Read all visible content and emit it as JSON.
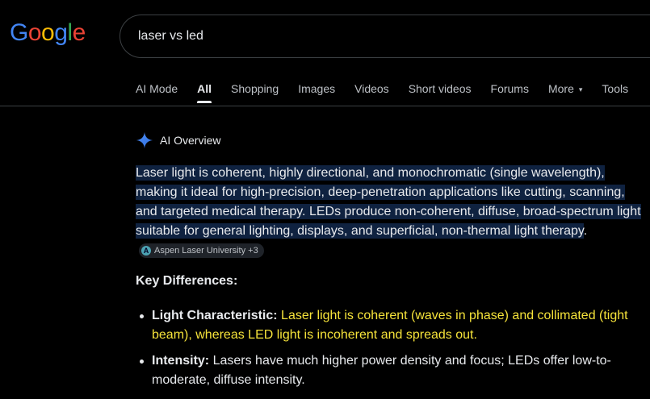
{
  "logo": {
    "letters": [
      {
        "ch": "G",
        "color": "#4285f4"
      },
      {
        "ch": "o",
        "color": "#ea4335"
      },
      {
        "ch": "o",
        "color": "#fbbc05"
      },
      {
        "ch": "g",
        "color": "#4285f4"
      },
      {
        "ch": "l",
        "color": "#34a853"
      },
      {
        "ch": "e",
        "color": "#ea4335"
      }
    ]
  },
  "search": {
    "query": "laser vs led"
  },
  "tabs": [
    {
      "label": "AI Mode",
      "active": false
    },
    {
      "label": "All",
      "active": true
    },
    {
      "label": "Shopping",
      "active": false
    },
    {
      "label": "Images",
      "active": false
    },
    {
      "label": "Videos",
      "active": false
    },
    {
      "label": "Short videos",
      "active": false
    },
    {
      "label": "Forums",
      "active": false
    },
    {
      "label": "More",
      "active": false,
      "dropdown": true
    },
    {
      "label": "Tools",
      "active": false
    }
  ],
  "ai_overview": {
    "label": "AI Overview",
    "icon": "sparkle-icon",
    "summary": "Laser light is coherent, highly directional, and monochromatic (single wavelength), making it ideal for high-precision, deep-penetration applications like cutting, scanning, and targeted medical therapy. LEDs produce non-coherent, diffuse, broad-spectrum light suitable for general lighting, displays, and superficial, non-thermal light therapy",
    "summary_end": ".",
    "citation": "Aspen Laser University +3",
    "key_heading": "Key Differences:",
    "bullets": [
      {
        "label": "Light Characteristic:",
        "text": "Laser light is coherent (waves in phase) and collimated (tight beam), whereas LED light is incoherent and spreads out.",
        "highlight_color": "#f6e33a"
      },
      {
        "label": "Intensity:",
        "text": "Lasers have much higher power density and focus; LEDs offer low-to-moderate, diffuse intensity."
      }
    ]
  },
  "colors": {
    "background": "#000000",
    "text": "#e8eaed",
    "highlight_bg": "#0f2240",
    "accent_yellow": "#f6e33a"
  }
}
